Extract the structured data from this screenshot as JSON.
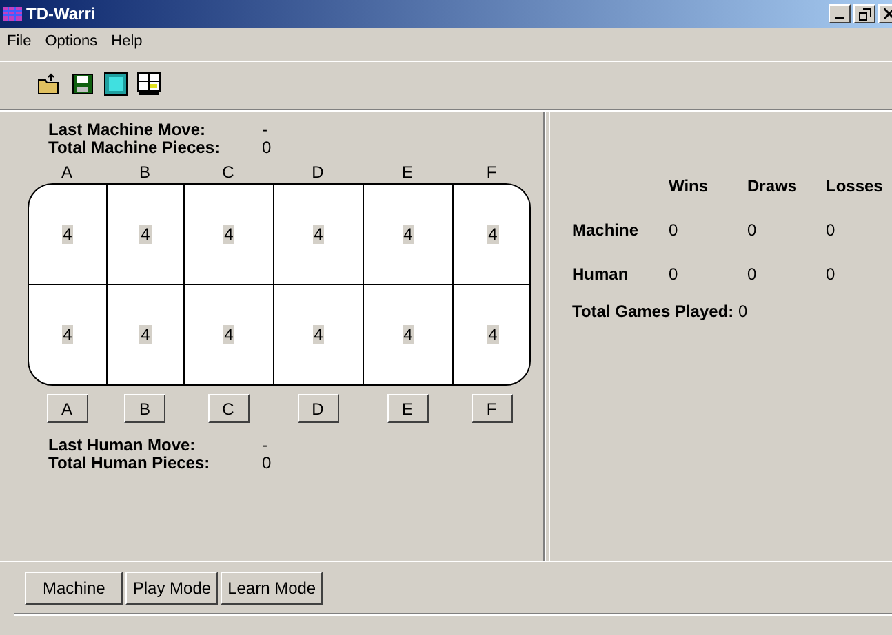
{
  "window": {
    "title": "TD-Warri"
  },
  "menu": [
    "File",
    "Options",
    "Help"
  ],
  "machine_info": {
    "last_move_label": "Last Machine Move:",
    "last_move": "-",
    "pieces_label": "Total Machine Pieces:",
    "pieces": "0"
  },
  "board": {
    "column_labels": [
      "A",
      "B",
      "C",
      "D",
      "E",
      "F"
    ],
    "rows": [
      [
        "4",
        "4",
        "4",
        "4",
        "4",
        "4"
      ],
      [
        "4",
        "4",
        "4",
        "4",
        "4",
        "4"
      ]
    ],
    "buttons": [
      "A",
      "B",
      "C",
      "D",
      "E",
      "F"
    ]
  },
  "human_info": {
    "last_move_label": "Last Human Move:",
    "last_move": "-",
    "pieces_label": "Total Human Pieces:",
    "pieces": "0"
  },
  "stats": {
    "columns": [
      "Wins",
      "Draws",
      "Losses"
    ],
    "rows": [
      {
        "label": "Machine",
        "values": [
          "0",
          "0",
          "0"
        ]
      },
      {
        "label": "Human",
        "values": [
          "0",
          "0",
          "0"
        ]
      }
    ],
    "total_label": "Total Games Played:",
    "total": "0"
  },
  "buttons": [
    "Machine",
    "Play Mode",
    "Learn Mode"
  ]
}
